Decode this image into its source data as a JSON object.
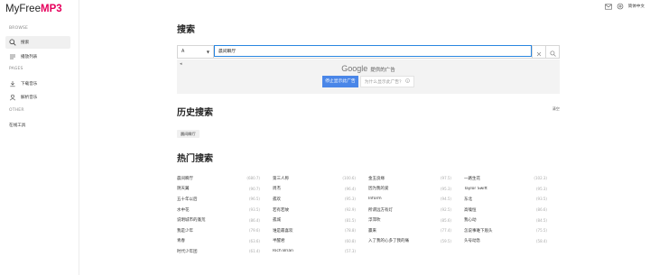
{
  "app": {
    "logo_main": "MyFree",
    "logo_accent": "MP3",
    "accent_color": "#e6005c"
  },
  "topbar": {
    "icons": [
      "mail-icon",
      "settings-icon"
    ],
    "language": "简体中文"
  },
  "sidebar": {
    "sections": [
      {
        "label": "BROWSE",
        "items": [
          {
            "label": "搜索",
            "icon": "search-icon",
            "active": true
          },
          {
            "label": "播放列表",
            "icon": "playlist-icon",
            "active": false
          }
        ]
      },
      {
        "label": "PAGES",
        "items": [
          {
            "label": "下载音乐",
            "icon": "download-icon",
            "active": false
          },
          {
            "label": "解析音乐",
            "icon": "user-icon",
            "active": false
          }
        ]
      },
      {
        "label": "OTHER",
        "items": [
          {
            "label": "在线工具",
            "icon": "",
            "active": false
          }
        ]
      }
    ]
  },
  "search": {
    "title": "搜索",
    "source_selected": "A",
    "query": "晨间瞬厅",
    "clear_icon": "close-icon",
    "search_icon": "search-icon"
  },
  "ad": {
    "arrow": "◂",
    "google_label": "Google",
    "provided_text": "提供的广告",
    "stop_button": "停止显示此广告",
    "why_button": "为什么显示此广告？",
    "why_icon": "info-icon"
  },
  "history": {
    "title": "历史搜索",
    "clear_label": "清空",
    "items": [
      "晨间瞬厅"
    ]
  },
  "hot": {
    "title": "热门搜索",
    "columns": [
      [
        {
          "name": "晨间瞬厅",
          "count": "(680.7)"
        },
        {
          "name": "阴天翼",
          "count": "(90.7)"
        },
        {
          "name": "五十年以后",
          "count": "(96.5)"
        },
        {
          "name": "水中花",
          "count": "(93.5)"
        },
        {
          "name": "说明城市的蓬荒",
          "count": "(86.4)"
        },
        {
          "name": "我是少年",
          "count": "(79.6)"
        },
        {
          "name": "青春",
          "count": "(63.6)"
        },
        {
          "name": "时代少年团",
          "count": "(61.4)"
        }
      ],
      [
        {
          "name": "第三人称",
          "count": "(100.6)"
        },
        {
          "name": "周杰",
          "count": "(96.4)"
        },
        {
          "name": "孤欢",
          "count": "(95.3)"
        },
        {
          "name": "若有若故",
          "count": "(92.9)"
        },
        {
          "name": "孤城",
          "count": "(81.5)"
        },
        {
          "name": "谁是最喜欢",
          "count": "(78.8)"
        },
        {
          "name": "半醒君",
          "count": "(60.8)"
        },
        {
          "name": "Rich Brian",
          "count": "(57.3)"
        }
      ],
      [
        {
          "name": "金玉良缘",
          "count": "(97.5)"
        },
        {
          "name": "因为我的爱",
          "count": "(95.3)"
        },
        {
          "name": "Inform",
          "count": "(94.5)"
        },
        {
          "name": "所谓远方有灯",
          "count": "(92.5)"
        },
        {
          "name": "浮萍吹",
          "count": "(85.6)"
        },
        {
          "name": "赢来",
          "count": "(77.4)"
        },
        {
          "name": "入了我的心多了我的痛",
          "count": "(59.5)"
        }
      ],
      [
        {
          "name": "一路生花",
          "count": "(102.3)"
        },
        {
          "name": "Taylor Swift",
          "count": "(95.3)"
        },
        {
          "name": "东北",
          "count": "(93.5)"
        },
        {
          "name": "高嗓恒",
          "count": "(86.6)"
        },
        {
          "name": "我心动",
          "count": "(84.5)"
        },
        {
          "name": "怎说事难下眉头",
          "count": "(75.5)"
        },
        {
          "name": "头号动急",
          "count": "(58.4)"
        }
      ]
    ]
  }
}
